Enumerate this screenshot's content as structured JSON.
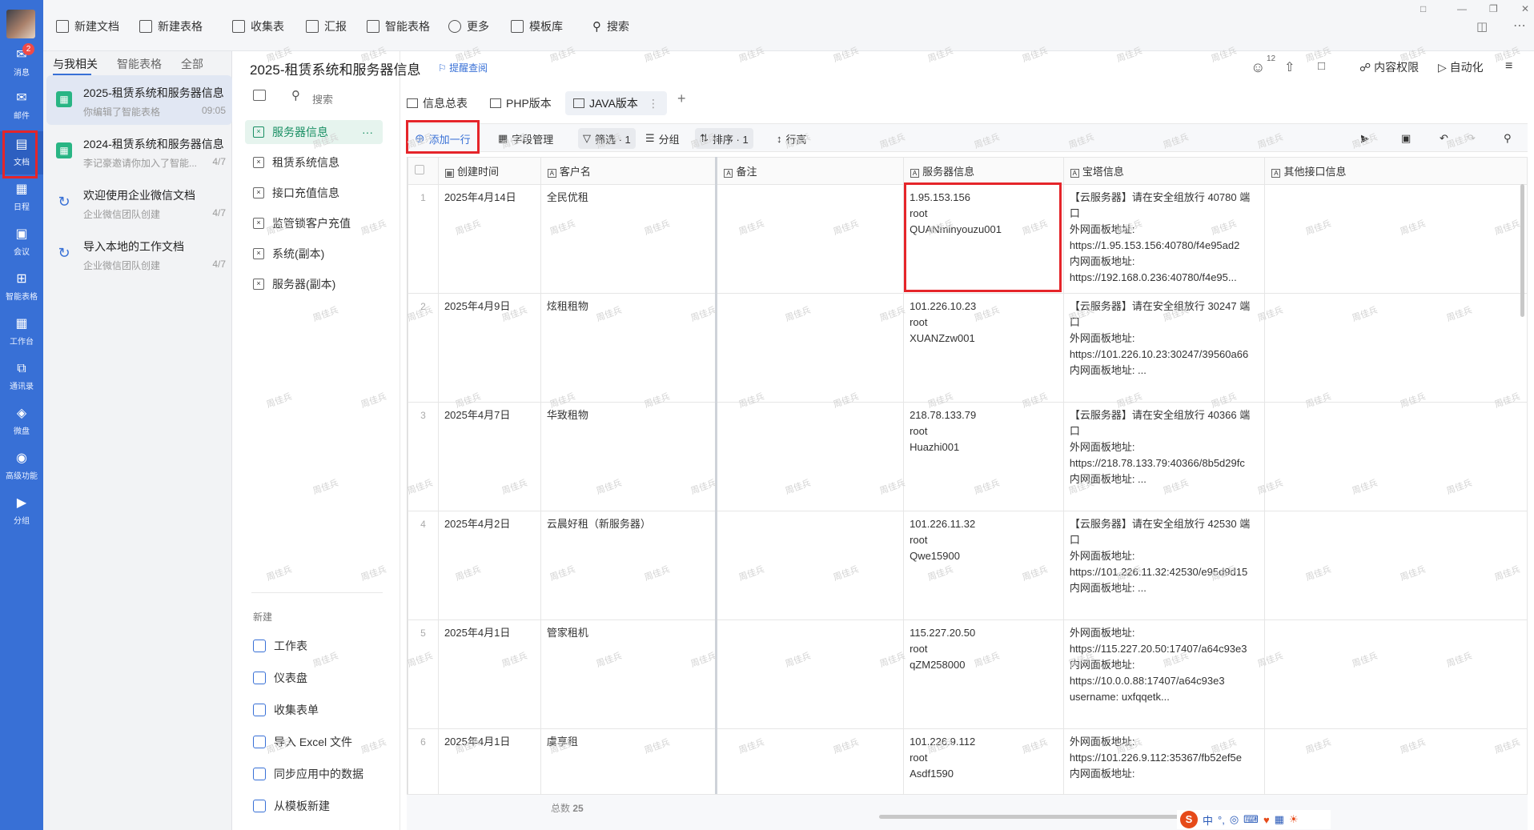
{
  "rail": {
    "items": [
      {
        "label": "消息",
        "icon": "message-icon",
        "badge": "2"
      },
      {
        "label": "邮件",
        "icon": "mail-icon"
      },
      {
        "label": "文档",
        "icon": "document-icon"
      },
      {
        "label": "日程",
        "icon": "calendar-icon"
      },
      {
        "label": "会议",
        "icon": "meeting-icon"
      },
      {
        "label": "智能表格",
        "icon": "smart-table-icon"
      },
      {
        "label": "工作台",
        "icon": "workbench-icon"
      },
      {
        "label": "通讯录",
        "icon": "contacts-icon"
      },
      {
        "label": "微盘",
        "icon": "drive-icon"
      },
      {
        "label": "高级功能",
        "icon": "advanced-icon"
      },
      {
        "label": "分组",
        "icon": "group-icon"
      }
    ]
  },
  "topbar": {
    "new_doc": "新建文档",
    "new_sheet": "新建表格",
    "collect": "收集表",
    "report": "汇报",
    "smart_sheet": "智能表格",
    "more": "更多",
    "templates": "模板库",
    "search": "搜索"
  },
  "docs_panel": {
    "tabs": [
      "与我相关",
      "智能表格",
      "全部"
    ],
    "items": [
      {
        "title": "2025-租赁系统和服务器信息",
        "sub": "你编辑了智能表格",
        "time": "09:05"
      },
      {
        "title": "2024-租赁系统和服务器信息",
        "sub": "李记豪邀请你加入了智能...",
        "time": "4/7"
      },
      {
        "title": "欢迎使用企业微信文档",
        "sub": "企业微信团队创建",
        "time": "4/7"
      },
      {
        "title": "导入本地的工作文档",
        "sub": "企业微信团队创建",
        "time": "4/7"
      }
    ]
  },
  "doc": {
    "title": "2025-租赁系统和服务器信息",
    "remind": "提醒查阅",
    "collaborators": "12",
    "permission": "内容权限",
    "automation": "自动化"
  },
  "sheets": {
    "search": "搜索",
    "items": [
      "服务器信息",
      "租赁系统信息",
      "接口充值信息",
      "监管锁客户充值",
      "系统(副本)",
      "服务器(副本)"
    ],
    "new_label": "新建",
    "new_items": [
      "工作表",
      "仪表盘",
      "收集表单",
      "导入 Excel 文件",
      "同步应用中的数据",
      "从模板新建"
    ]
  },
  "views": {
    "tabs": [
      "信息总表",
      "PHP版本",
      "JAVA版本"
    ]
  },
  "toolbar": {
    "add_row": "添加一行",
    "fields": "字段管理",
    "filter": "筛选 · 1",
    "group": "分组",
    "sort": "排序 · 1",
    "row_height": "行高"
  },
  "grid": {
    "columns": [
      "创建时间",
      "客户名",
      "备注",
      "服务器信息",
      "宝塔信息",
      "其他接口信息"
    ],
    "rows": [
      {
        "n": "1",
        "date": "2025年4月14日",
        "customer": "全民优租",
        "note": "",
        "server": "1.95.153.156\nroot\nQUANminyouzu001",
        "bt": "【云服务器】请在安全组放行 40780 端口\n 外网面板地址:\nhttps://1.95.153.156:40780/f4e95ad2\n 内网面板地址:\nhttps://192.168.0.236:40780/f4e95...",
        "other": ""
      },
      {
        "n": "2",
        "date": "2025年4月9日",
        "customer": "炫租租物",
        "note": "",
        "server": "101.226.10.23\nroot\nXUANZzw001",
        "bt": "【云服务器】请在安全组放行 30247 端口\n 外网面板地址:\nhttps://101.226.10.23:30247/39560a66\n 内网面板地址: ...",
        "other": ""
      },
      {
        "n": "3",
        "date": "2025年4月7日",
        "customer": "华致租物",
        "note": "",
        "server": "218.78.133.79\nroot\nHuazhi001",
        "bt": "【云服务器】请在安全组放行 40366 端口\n 外网面板地址:\nhttps://218.78.133.79:40366/8b5d29fc\n 内网面板地址: ...",
        "other": ""
      },
      {
        "n": "4",
        "date": "2025年4月2日",
        "customer": "云晨好租（新服务器）",
        "note": "",
        "server": "101.226.11.32\nroot\nQwe15900",
        "bt": "【云服务器】请在安全组放行 42530 端口\n 外网面板地址:\nhttps://101.226.11.32:42530/e95d9d15\n 内网面板地址: ...",
        "other": ""
      },
      {
        "n": "5",
        "date": "2025年4月1日",
        "customer": "管家租机",
        "note": "",
        "server": "115.227.20.50\nroot\nqZM258000",
        "bt": "外网面板地址:\nhttps://115.227.20.50:17407/a64c93e3\n 内网面板地址:\nhttps://10.0.0.88:17407/a64c93e3\n username: uxfqqetk...",
        "other": ""
      },
      {
        "n": "6",
        "date": "2025年4月1日",
        "customer": "虞享租",
        "note": "",
        "server": "101.226.9.112\nroot\nAsdf1590",
        "bt": "外网面板地址:\nhttps://101.226.9.112:35367/fb52ef5e\n 内网面板地址:",
        "other": ""
      }
    ],
    "total_label": "总数",
    "total": "25"
  },
  "ime": {
    "lang": "中"
  },
  "watermark": "周佳兵"
}
